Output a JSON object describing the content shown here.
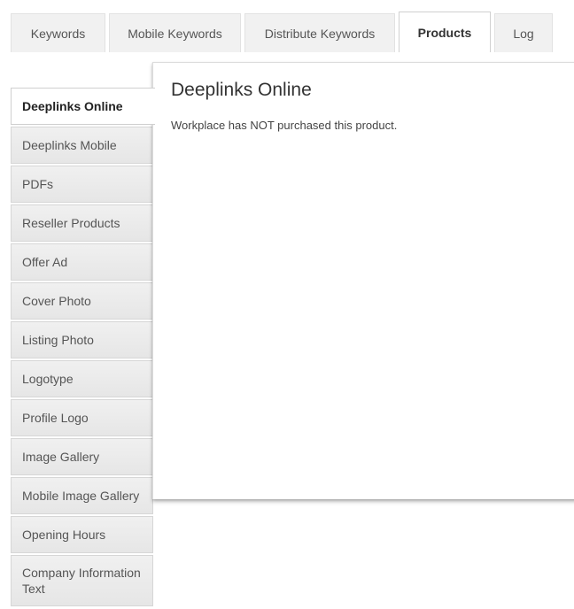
{
  "top_tabs": [
    {
      "label": "Keywords"
    },
    {
      "label": "Mobile Keywords"
    },
    {
      "label": "Distribute Keywords"
    },
    {
      "label": "Products"
    },
    {
      "label": "Log"
    }
  ],
  "side_tabs": [
    {
      "label": "Deeplinks Online"
    },
    {
      "label": "Deeplinks Mobile"
    },
    {
      "label": "PDFs"
    },
    {
      "label": "Reseller Products"
    },
    {
      "label": "Offer Ad"
    },
    {
      "label": "Cover Photo"
    },
    {
      "label": "Listing Photo"
    },
    {
      "label": "Logotype"
    },
    {
      "label": "Profile Logo"
    },
    {
      "label": "Image Gallery"
    },
    {
      "label": "Mobile Image Gallery"
    },
    {
      "label": "Opening Hours"
    },
    {
      "label": "Company Information Text"
    }
  ],
  "panel": {
    "title": "Deeplinks Online",
    "message": "Workplace has NOT purchased this product."
  }
}
